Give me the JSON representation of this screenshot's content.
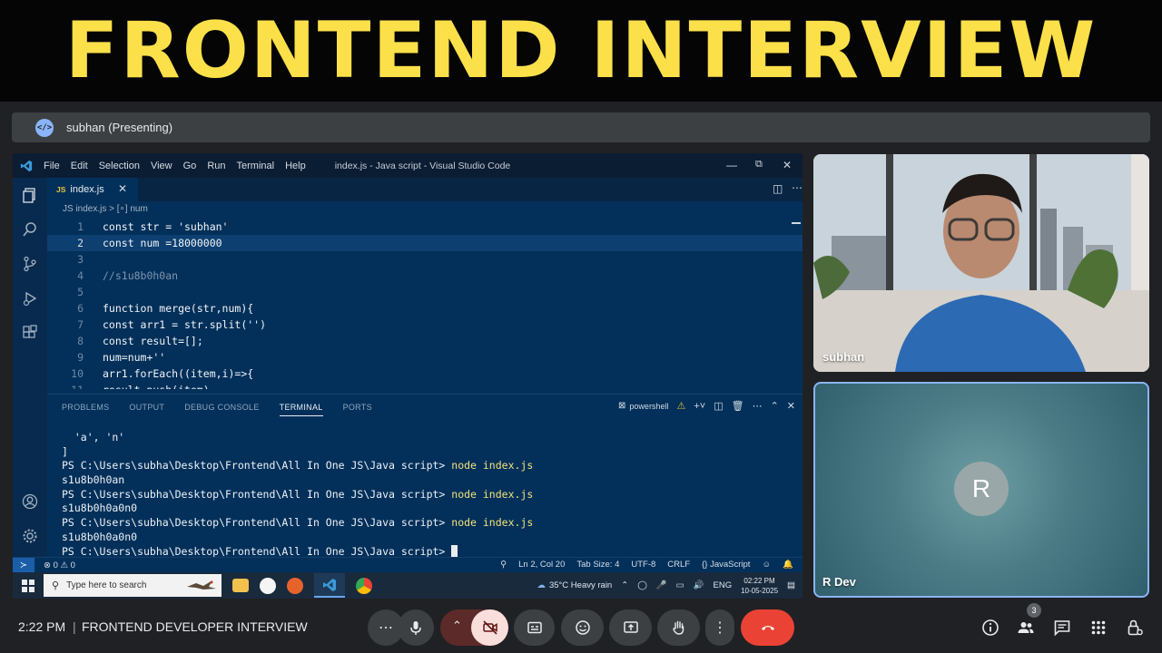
{
  "banner": {
    "title": "FRONTEND INTERVIEW"
  },
  "presenting": {
    "label": "subhan (Presenting)"
  },
  "vscode": {
    "menu": [
      "File",
      "Edit",
      "Selection",
      "View",
      "Go",
      "Run",
      "Terminal",
      "Help"
    ],
    "window_title": "index.js - Java script - Visual Studio Code",
    "tab": {
      "badge": "JS",
      "name": "index.js"
    },
    "breadcrumb": "JS index.js > [∘] num",
    "code": [
      {
        "num": "1",
        "text": "const str = 'subhan'"
      },
      {
        "num": "2",
        "text": "const num =18000000"
      },
      {
        "num": "3",
        "text": ""
      },
      {
        "num": "4",
        "text": "//s1u8b0h0an"
      },
      {
        "num": "5",
        "text": ""
      },
      {
        "num": "6",
        "text": "function merge(str,num){"
      },
      {
        "num": "7",
        "text": "const arr1 = str.split('')"
      },
      {
        "num": "8",
        "text": "const result=[];"
      },
      {
        "num": "9",
        "text": "num=num+''"
      },
      {
        "num": "10",
        "text": "arr1.forEach((item,i)=>{"
      },
      {
        "num": "11",
        "text": "result.push(item)"
      }
    ],
    "panel_tabs": [
      "PROBLEMS",
      "OUTPUT",
      "DEBUG CONSOLE",
      "TERMINAL",
      "PORTS"
    ],
    "shell": "powershell",
    "terminal": {
      "lines": [
        "  'a', 'n'",
        "]",
        "PS C:\\Users\\subha\\Desktop\\Frontend\\All In One JS\\Java script> ",
        "s1u8b0h0an",
        "PS C:\\Users\\subha\\Desktop\\Frontend\\All In One JS\\Java script> ",
        "s1u8b0h0a0n0",
        "PS C:\\Users\\subha\\Desktop\\Frontend\\All In One JS\\Java script> ",
        "s1u8b0h0a0n0",
        "PS C:\\Users\\subha\\Desktop\\Frontend\\All In One JS\\Java script> "
      ],
      "command": "node index.js"
    },
    "status": {
      "problems": "⊗ 0 ⚠ 0",
      "position": "Ln 2, Col 20",
      "tab_size": "Tab Size: 4",
      "encoding": "UTF-8",
      "eol": "CRLF",
      "language": "{} JavaScript"
    }
  },
  "taskbar": {
    "search_placeholder": "Type here to search",
    "weather": "35°C  Heavy rain",
    "lang": "ENG",
    "time": "02:22 PM",
    "date": "10-05-2025"
  },
  "participants": {
    "video_name": "subhan",
    "other_name": "R Dev",
    "other_initial": "R",
    "count": "3"
  },
  "meeting": {
    "time": "2:22 PM",
    "separator": "|",
    "title": "FRONTEND DEVELOPER INTERVIEW"
  },
  "colors": {
    "banner_text": "#fbe04a",
    "end_call": "#ea4335",
    "camera_off": "#f9dedc",
    "tile_border": "#8ab4f8"
  }
}
